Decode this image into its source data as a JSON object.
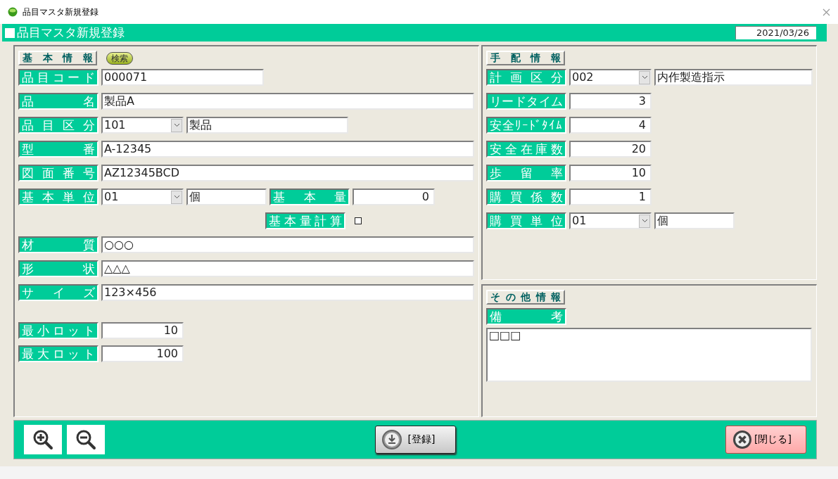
{
  "window": {
    "title": "品目マスタ新規登録"
  },
  "header": {
    "title": "品目マスタ新規登録",
    "date": "2021/03/26"
  },
  "basic_info": {
    "heading": "基本情報",
    "search_button": "検索",
    "rows": [
      [
        {
          "kind": "label",
          "text": "品目コード"
        },
        {
          "kind": "code",
          "value": "000071"
        }
      ],
      [
        {
          "kind": "label",
          "text": "品名"
        },
        {
          "kind": "text",
          "value": "製品A"
        }
      ],
      [
        {
          "kind": "label",
          "text": "品目区分"
        },
        {
          "kind": "combo",
          "value": "101",
          "name": "製品"
        }
      ],
      [
        {
          "kind": "label",
          "text": "型番"
        },
        {
          "kind": "text",
          "value": "A-12345"
        }
      ],
      [
        {
          "kind": "label",
          "text": "図面番号"
        },
        {
          "kind": "text",
          "value": "AZ12345BCD"
        }
      ],
      [
        {
          "kind": "label",
          "text": "基本単位"
        },
        {
          "kind": "unit",
          "value": "01",
          "name": "個"
        },
        {
          "kind": "label",
          "text": "基本量"
        },
        {
          "kind": "number",
          "value": "0"
        }
      ],
      [
        {
          "kind": "blank"
        },
        {
          "kind": "blank"
        },
        {
          "kind": "label",
          "text": "基本量計算"
        },
        {
          "kind": "checkbox",
          "checked": false
        }
      ],
      [
        {
          "kind": "label",
          "text": "材質"
        },
        {
          "kind": "text",
          "value": "○○○"
        }
      ],
      [
        {
          "kind": "label",
          "text": "形状"
        },
        {
          "kind": "text",
          "value": "△△△"
        }
      ],
      [
        {
          "kind": "label",
          "text": "サイズ"
        },
        {
          "kind": "text",
          "value": "123×456"
        }
      ]
    ],
    "lot_rows": [
      [
        {
          "kind": "label",
          "text": "最小ロット"
        },
        {
          "kind": "number",
          "value": "10"
        }
      ],
      [
        {
          "kind": "label",
          "text": "最大ロット"
        },
        {
          "kind": "number",
          "value": "100"
        }
      ]
    ]
  },
  "arrangement_info": {
    "heading": "手配情報",
    "rows": [
      [
        {
          "kind": "label",
          "text": "計画区分"
        },
        {
          "kind": "combo",
          "value": "002",
          "name": "内作製造指示"
        }
      ],
      [
        {
          "kind": "label",
          "text": "リードタイム"
        },
        {
          "kind": "number",
          "value": "3"
        }
      ],
      [
        {
          "kind": "label",
          "text": "安全ﾘｰﾄﾞﾀｲﾑ"
        },
        {
          "kind": "number",
          "value": "4"
        }
      ],
      [
        {
          "kind": "label",
          "text": "安全在庫数"
        },
        {
          "kind": "number",
          "value": "20"
        }
      ],
      [
        {
          "kind": "label",
          "text": "歩留率"
        },
        {
          "kind": "number",
          "value": "10"
        }
      ],
      [
        {
          "kind": "label",
          "text": "購買係数"
        },
        {
          "kind": "number",
          "value": "1"
        }
      ],
      [
        {
          "kind": "label",
          "text": "購買単位"
        },
        {
          "kind": "unit",
          "value": "01",
          "name": "個"
        }
      ]
    ]
  },
  "other_info": {
    "heading": "その他情報",
    "remarks_label": "備考",
    "remarks": "□□□"
  },
  "footer": {
    "buttons": [
      {
        "kind": "zoom-in"
      },
      {
        "kind": "zoom-out"
      },
      {
        "kind": "register",
        "label": "[登録]"
      },
      {
        "kind": "close",
        "label": "[閉じる]"
      }
    ]
  }
}
